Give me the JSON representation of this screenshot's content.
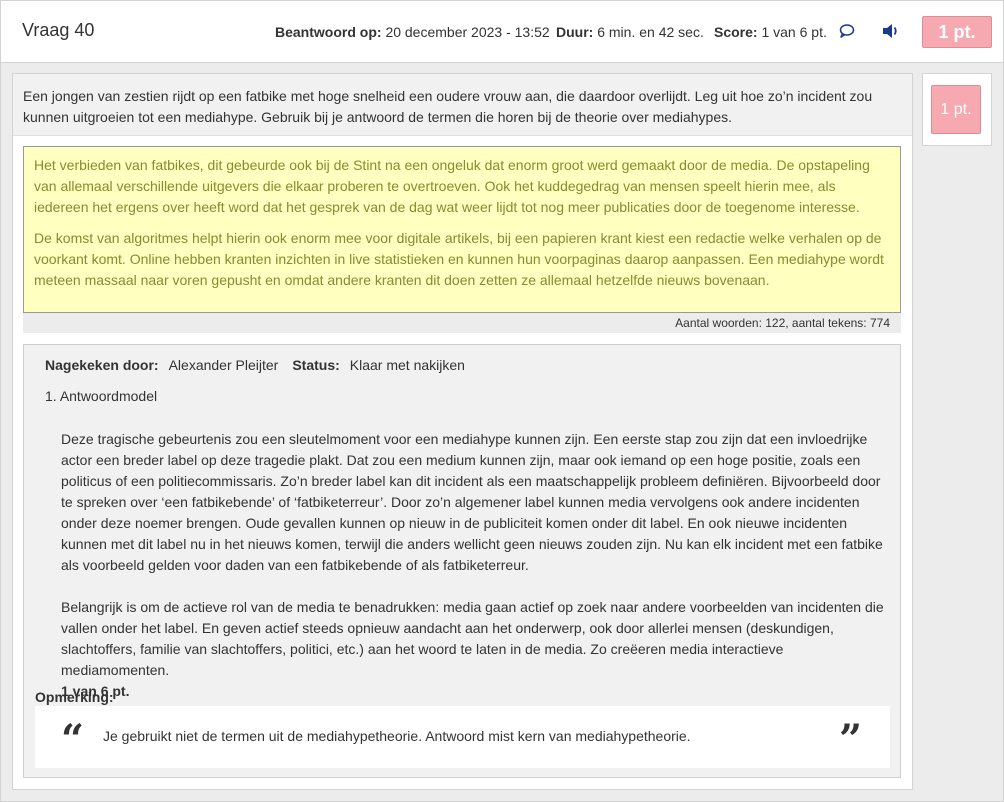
{
  "header": {
    "title": "Vraag 40",
    "answered_label": "Beantwoord op:",
    "answered_value": "20 december 2023 - 13:52",
    "duration_label": "Duur:",
    "duration_value": "6 min. en 42 sec.",
    "score_label": "Score:",
    "score_value": "1 van 6 pt.",
    "points_badge": "1 pt."
  },
  "question": {
    "text": "Een jongen van zestien rijdt op een fatbike met hoge snelheid een oudere vrouw aan, die daardoor overlijdt. Leg uit hoe zo’n incident zou kunnen uitgroeien tot een mediahype. Gebruik bij je antwoord de termen die horen bij de theorie over mediahypes."
  },
  "answer": {
    "paragraph_1": "Het verbieden van fatbikes, dit gebeurde ook bij de Stint na een ongeluk dat enorm groot werd gemaakt door de media. De opstapeling van allemaal verschillende uitgevers die elkaar proberen te overtroeven. Ook het kuddegedrag van mensen speelt hierin mee, als iedereen het ergens over heeft word dat het gesprek van de dag wat weer lijdt tot nog meer publicaties door de toegenome interesse.",
    "paragraph_2": "De komst van algoritmes helpt hierin ook enorm mee voor digitale artikels, bij een papieren krant kiest een redactie welke verhalen op de voorkant komt. Online hebben kranten inzichten in live statistieken en kunnen hun voorpaginas daarop aanpassen. Een mediahype wordt meteen massaal naar voren gepusht en omdat andere kranten dit doen zetten ze allemaal hetzelfde nieuws bovenaan.",
    "counter": "Aantal woorden: 122, aantal tekens: 774"
  },
  "review": {
    "graded_by_label": "Nagekeken door:",
    "graded_by_value": "Alexander Pleijter",
    "status_label": "Status:",
    "status_value": "Klaar met nakijken",
    "model_number": "1.",
    "model_title": "Antwoordmodel",
    "model_paragraph_1": "Deze tragische gebeurtenis zou een sleutelmoment voor een mediahype kunnen zijn. Een eerste stap zou zijn dat een invloedrijke actor een breder label op deze tragedie plakt. Dat zou een medium kunnen zijn, maar ook iemand op een hoge positie, zoals een politicus of een politiecommissaris. Zo’n breder label kan dit incident als een maatschappelijk probleem definiëren. Bijvoorbeeld door te spreken over ‘een fatbikebende’ of ‘fatbiketerreur’. Door zo’n algemener label kunnen media vervolgens ook andere incidenten onder deze noemer brengen. Oude gevallen kunnen op nieuw in de publiciteit komen onder dit label. En ook nieuwe incidenten kunnen met dit label nu in het nieuws komen, terwijl die anders wellicht geen nieuws zouden zijn. Nu kan elk incident met een fatbike als voorbeeld gelden voor daden van een fatbikebende of als fatbiketerreur.",
    "model_paragraph_2": "Belangrijk is om de actieve rol van de media te benadrukken: media gaan actief op zoek naar andere voorbeelden van incidenten die vallen onder het label. En geven actief steeds opnieuw aandacht aan het onderwerp, ook door allerlei mensen (deskundigen, slachtoffers, familie van slachtoffers, politici, etc.) aan het woord te laten in de media. Zo creëeren media interactieve mediamomenten.",
    "model_score": "1 van 6 pt.",
    "remark_label": "Opmerking:",
    "remark_text": "Je gebruikt niet de termen uit de mediahypetheorie. Antwoord mist kern van mediahypetheorie."
  },
  "side": {
    "points_badge": "1 pt."
  },
  "icons": {
    "comment": "comment-icon",
    "audio": "speaker-icon",
    "quote_open": "quote-open-icon",
    "quote_close": "quote-close-icon"
  },
  "colors": {
    "badge_bg": "#f7a9b2",
    "answer_bg": "#ffffc0",
    "answer_text": "#8a8a30",
    "audio_icon": "#1a3a8f"
  }
}
